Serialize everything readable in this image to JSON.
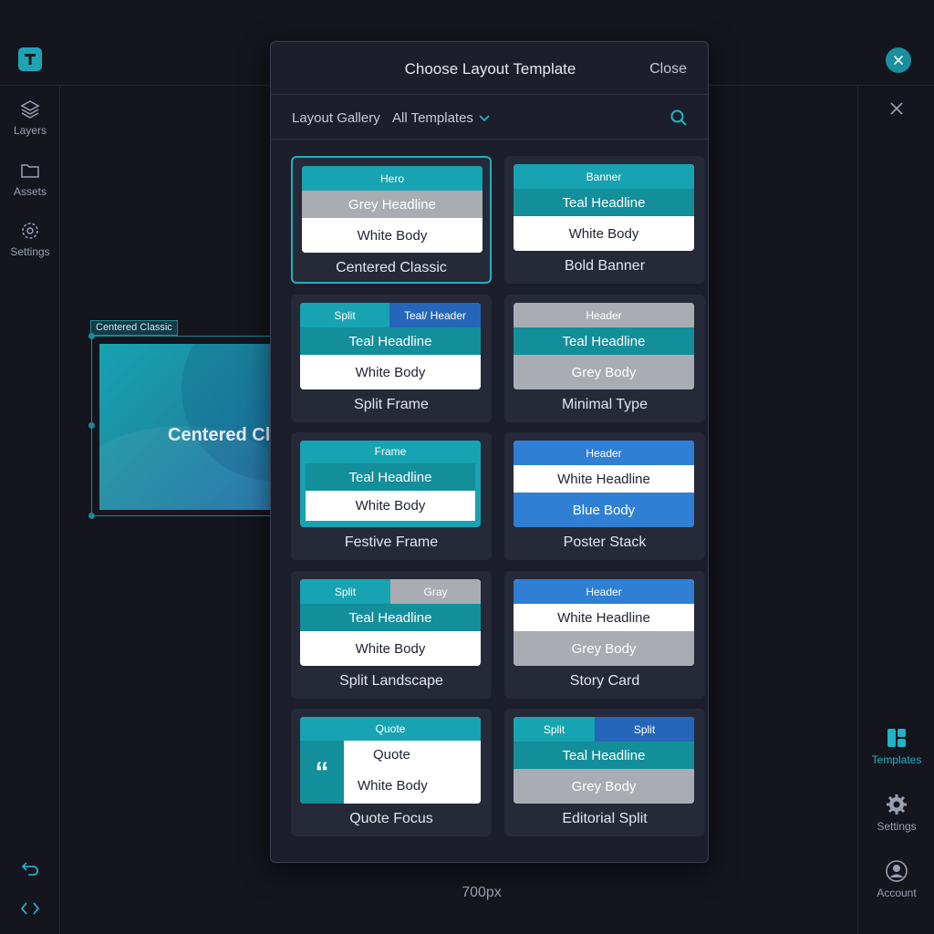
{
  "colors": {
    "accent": "#1fb0c0",
    "background": "#14151d",
    "modal": "#1c1e2b"
  },
  "left_rail": [
    {
      "label": "Layers",
      "icon": "layers-icon"
    },
    {
      "label": "Assets",
      "icon": "folder-icon"
    },
    {
      "label": "Settings",
      "icon": "gear-icon"
    }
  ],
  "right_rail": [
    {
      "label": "Templates",
      "icon": "templates-icon"
    },
    {
      "label": "Settings",
      "icon": "gear-icon"
    },
    {
      "label": "Account",
      "icon": "account-icon"
    }
  ],
  "canvas": {
    "selected_tag": "Centered Classic",
    "preview_title": "Centered Cla",
    "size_label": "700px"
  },
  "modal": {
    "title": "Choose Layout Template",
    "close_label": "Close",
    "gallery_label": "Layout Gallery",
    "filter_value": "All Templates"
  },
  "templates": [
    {
      "name": "Centered Classic",
      "selected": true,
      "thumb": [
        "Hero",
        "Grey Headline",
        "White Body"
      ]
    },
    {
      "name": "Bold Banner",
      "thumb": [
        "Banner",
        "Teal Headline",
        "White Body"
      ]
    },
    {
      "name": "Split Frame",
      "thumb": [
        "Split",
        "Teal/ Header",
        "Teal Headline",
        "White Body"
      ]
    },
    {
      "name": "Minimal Type",
      "thumb": [
        "Header",
        "Teal Headline",
        "Grey Body"
      ]
    },
    {
      "name": "Festive Frame",
      "thumb": [
        "Frame",
        "Teal Headline",
        "White Body"
      ]
    },
    {
      "name": "Poster Stack",
      "thumb": [
        "Header",
        "White Headline",
        "Blue Body"
      ]
    },
    {
      "name": "Split Landscape",
      "thumb": [
        "Split",
        "Gray",
        "Teal Headline",
        "White Body"
      ]
    },
    {
      "name": "Story Card",
      "thumb": [
        "Header",
        "White Headline",
        "Grey Body"
      ]
    },
    {
      "name": "Quote Focus",
      "thumb": [
        "Quote",
        "Quote",
        "White Body"
      ]
    },
    {
      "name": "Editorial Split",
      "thumb": [
        "Split",
        "Split",
        "Teal Headline",
        "Grey Body"
      ]
    }
  ]
}
